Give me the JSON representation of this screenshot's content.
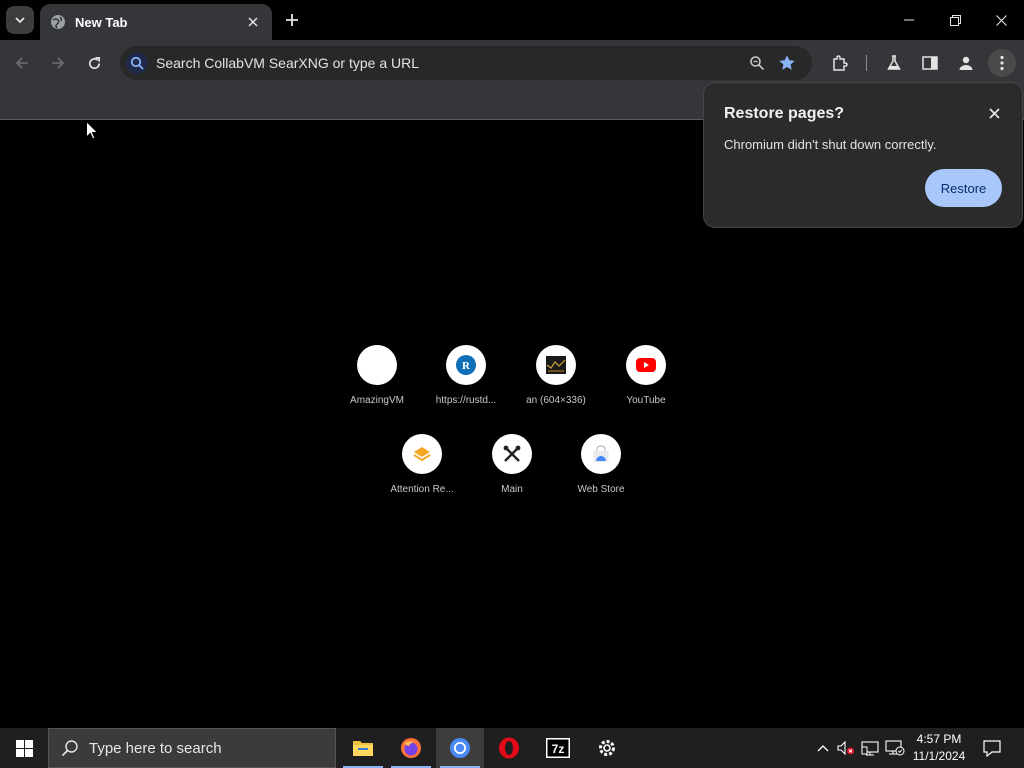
{
  "browser": {
    "tab": {
      "title": "New Tab"
    },
    "omnibox": {
      "placeholder": "Search CollabVM SearXNG or type a URL"
    }
  },
  "restore_popup": {
    "title": "Restore pages?",
    "message": "Chromium didn't shut down correctly.",
    "button_label": "Restore"
  },
  "shortcuts": [
    {
      "label": "AmazingVM",
      "icon": "blank-icon"
    },
    {
      "label": "https://rustd...",
      "icon": "rust-r-icon"
    },
    {
      "label": "an (604×336)",
      "icon": "image-thumbnail-icon"
    },
    {
      "label": "YouTube",
      "icon": "youtube-icon"
    },
    {
      "label": "Attention Re...",
      "icon": "attention-icon"
    },
    {
      "label": "Main",
      "icon": "tools-icon"
    },
    {
      "label": "Web Store",
      "icon": "web-store-icon"
    }
  ],
  "taskbar": {
    "search_placeholder": "Type here to search",
    "apps": [
      "file-explorer-icon",
      "firefox-icon",
      "chromium-icon",
      "opera-icon",
      "7zip-icon",
      "settings-icon"
    ],
    "clock": {
      "time": "4:57 PM",
      "date": "11/1/2024"
    }
  },
  "colors": {
    "tab_bg": "#35363a",
    "omnibox_bg": "#282828",
    "restore_button": "#a8c7fa",
    "bookmark_star": "#8ab4f8"
  }
}
